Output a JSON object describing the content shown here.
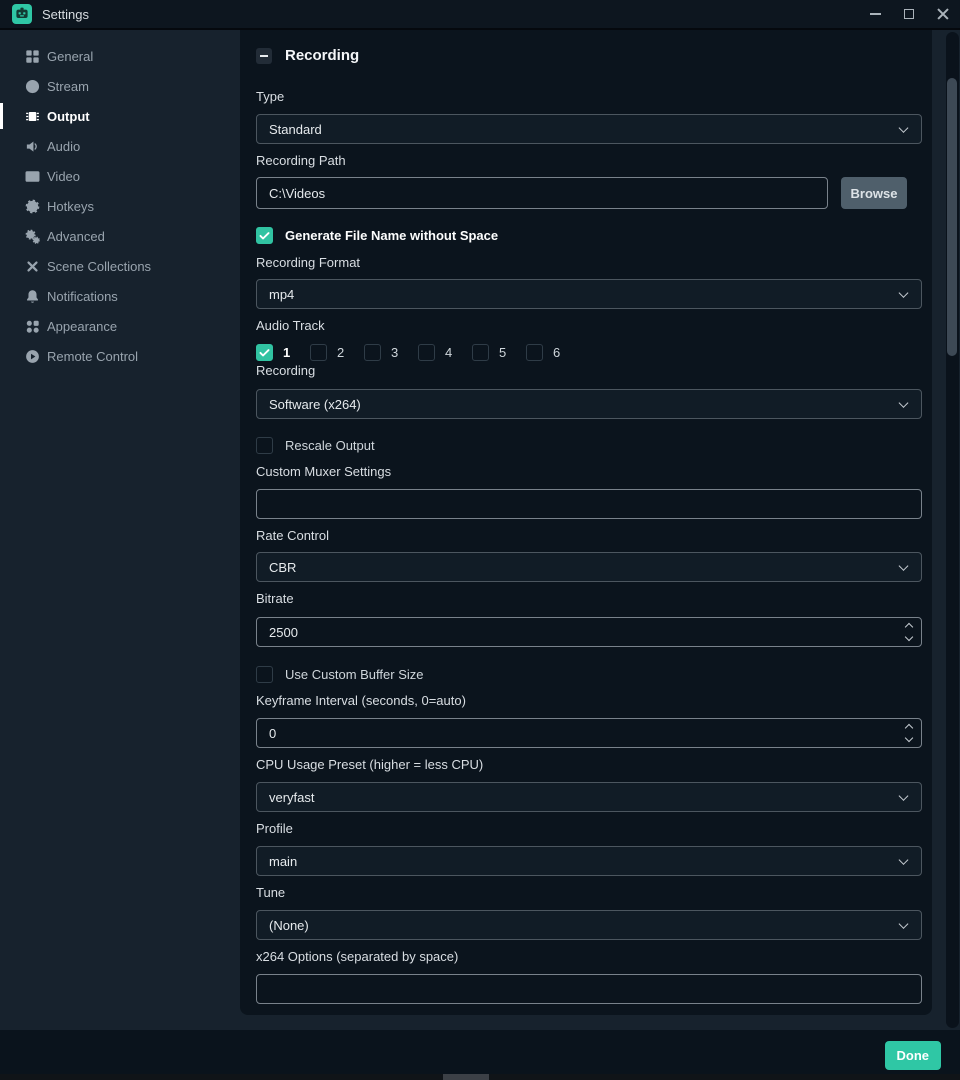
{
  "titlebar": {
    "title": "Settings"
  },
  "sidebar": {
    "items": [
      {
        "label": "General",
        "icon": "grid-icon",
        "active": false
      },
      {
        "label": "Stream",
        "icon": "globe-icon",
        "active": false
      },
      {
        "label": "Output",
        "icon": "chip-icon",
        "active": true
      },
      {
        "label": "Audio",
        "icon": "speaker-icon",
        "active": false
      },
      {
        "label": "Video",
        "icon": "film-icon",
        "active": false
      },
      {
        "label": "Hotkeys",
        "icon": "gear-icon",
        "active": false
      },
      {
        "label": "Advanced",
        "icon": "gears-icon",
        "active": false
      },
      {
        "label": "Scene Collections",
        "icon": "tools-icon",
        "active": false
      },
      {
        "label": "Notifications",
        "icon": "bell-icon",
        "active": false
      },
      {
        "label": "Appearance",
        "icon": "shapes-icon",
        "active": false
      },
      {
        "label": "Remote Control",
        "icon": "play-circle-icon",
        "active": false
      }
    ]
  },
  "recording": {
    "section_title": "Recording",
    "type": {
      "label": "Type",
      "value": "Standard"
    },
    "recording_path": {
      "label": "Recording Path",
      "value": "C:\\Videos",
      "browse_label": "Browse"
    },
    "generate_file_name": {
      "label": "Generate File Name without Space",
      "checked": true
    },
    "recording_format": {
      "label": "Recording Format",
      "value": "mp4"
    },
    "audio_track": {
      "label": "Audio Track",
      "tracks": [
        {
          "n": "1",
          "checked": true
        },
        {
          "n": "2",
          "checked": false
        },
        {
          "n": "3",
          "checked": false
        },
        {
          "n": "4",
          "checked": false
        },
        {
          "n": "5",
          "checked": false
        },
        {
          "n": "6",
          "checked": false
        }
      ]
    },
    "encoder": {
      "label": "Recording",
      "value": "Software (x264)"
    },
    "rescale_output": {
      "label": "Rescale Output",
      "checked": false
    },
    "custom_muxer": {
      "label": "Custom Muxer Settings",
      "value": ""
    },
    "rate_control": {
      "label": "Rate Control",
      "value": "CBR"
    },
    "bitrate": {
      "label": "Bitrate",
      "value": "2500"
    },
    "use_custom_buffer": {
      "label": "Use Custom Buffer Size",
      "checked": false
    },
    "keyframe_interval": {
      "label": "Keyframe Interval (seconds, 0=auto)",
      "value": "0"
    },
    "cpu_preset": {
      "label": "CPU Usage Preset (higher = less CPU)",
      "value": "veryfast"
    },
    "profile": {
      "label": "Profile",
      "value": "main"
    },
    "tune": {
      "label": "Tune",
      "value": "(None)"
    },
    "x264_options": {
      "label": "x264 Options (separated by space)",
      "value": ""
    }
  },
  "footer": {
    "done_label": "Done"
  },
  "colors": {
    "accent": "#2fc7a5",
    "checkbox_checked": "#31c3a2",
    "sidebar_bg": "#17222d",
    "panel_bg": "#0b141d",
    "titlebar_bg": "#0d161f",
    "footer_bg": "#0a131c",
    "browse_button_bg": "#4f5f6b"
  }
}
